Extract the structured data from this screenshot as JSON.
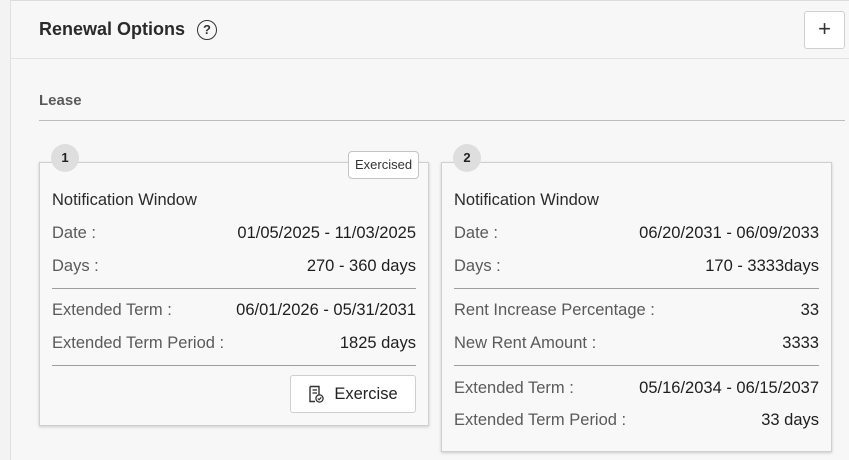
{
  "header": {
    "title": "Renewal Options",
    "help_icon": "?",
    "add_icon": "+"
  },
  "section": {
    "label": "Lease"
  },
  "cards": [
    {
      "number": "1",
      "tag": "Exercised",
      "heading": "Notification Window",
      "date_label": "Date :",
      "date_value": "01/05/2025 - 11/03/2025",
      "days_label": "Days :",
      "days_value": "270 - 360 days",
      "ext_term_label": "Extended Term :",
      "ext_term_value": "06/01/2026 - 05/31/2031",
      "ext_period_label": "Extended Term Period :",
      "ext_period_value": "1825 days",
      "exercise_label": "Exercise"
    },
    {
      "number": "2",
      "heading": "Notification Window",
      "date_label": "Date :",
      "date_value": "06/20/2031 - 06/09/2033",
      "days_label": "Days :",
      "days_value": "170 - 3333days",
      "rent_pct_label": "Rent Increase Percentage :",
      "rent_pct_value": "33",
      "new_rent_label": "New Rent Amount :",
      "new_rent_value": "3333",
      "ext_term_label": "Extended Term :",
      "ext_term_value": "05/16/2034 - 06/15/2037",
      "ext_period_label": "Extended Term Period :",
      "ext_period_value": "33 days"
    }
  ]
}
